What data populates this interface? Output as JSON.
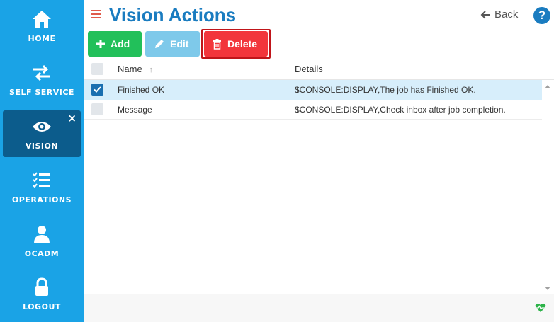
{
  "sidebar": {
    "items": [
      {
        "label": "HOME",
        "icon": "home-icon"
      },
      {
        "label": "SELF SERVICE",
        "icon": "swap-arrows-icon"
      },
      {
        "label": "VISION",
        "icon": "eye-icon",
        "active": true,
        "close": "×"
      },
      {
        "label": "OPERATIONS",
        "icon": "checklist-icon"
      },
      {
        "label": "OCADM",
        "icon": "user-icon"
      },
      {
        "label": "LOGOUT",
        "icon": "lock-icon"
      }
    ]
  },
  "header": {
    "title": "Vision Actions",
    "back_label": "Back",
    "help_label": "?"
  },
  "toolbar": {
    "add_label": "Add",
    "edit_label": "Edit",
    "delete_label": "Delete"
  },
  "table": {
    "columns": [
      "Name",
      "Details"
    ],
    "sort_indicator": "↑",
    "rows": [
      {
        "name": "Finished OK",
        "details": "$CONSOLE:DISPLAY,The job has Finished OK.",
        "checked": true
      },
      {
        "name": "Message",
        "details": "$CONSOLE:DISPLAY,Check inbox after job completion.",
        "checked": false
      }
    ]
  },
  "colors": {
    "sidebar": "#1aa3e6",
    "active_nav": "#0c5c8c",
    "title": "#1a7cc0",
    "add": "#22c05a",
    "edit": "#7ec9ea",
    "delete": "#f2353b",
    "selected_row": "#d7eefb"
  }
}
